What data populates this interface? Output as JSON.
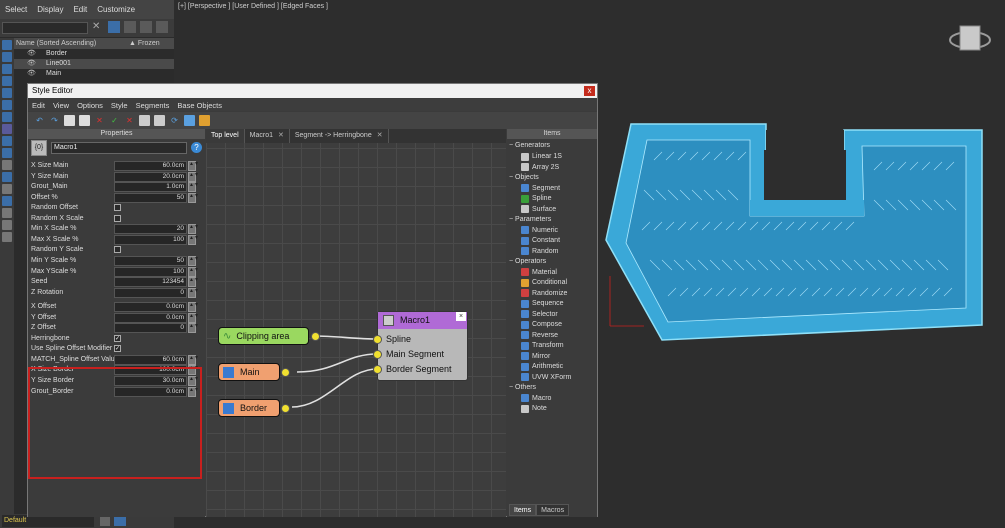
{
  "main_menu": [
    "Select",
    "Display",
    "Edit",
    "Customize"
  ],
  "scene_explorer": {
    "column_name": "Name (Sorted Ascending)",
    "column_frozen": "▲ Frozen",
    "rows": [
      "Border",
      "Line001",
      "Main"
    ]
  },
  "viewport_label": "[+] [Perspective ] [User Defined ] [Edged Faces ]",
  "status_selector": "Default",
  "style_editor": {
    "title": "Style Editor",
    "close": "x",
    "menu": [
      "Edit",
      "View",
      "Options",
      "Style",
      "Segments",
      "Base Objects"
    ],
    "properties_header": "Properties",
    "macro_name": "Macro1",
    "macro_icon_text": "{0}",
    "properties": [
      {
        "label": "X Size Main",
        "value": "60.0cm",
        "type": "num"
      },
      {
        "label": "Y  Size  Main",
        "value": "20.0cm",
        "type": "num"
      },
      {
        "label": "Grout_Main",
        "value": "1.0cm",
        "type": "num"
      },
      {
        "label": "Offset %",
        "value": "50",
        "type": "num"
      },
      {
        "label": "Random Offset",
        "value": "",
        "type": "check"
      },
      {
        "label": "Random X Scale",
        "value": "",
        "type": "check"
      },
      {
        "label": "Min X Scale %",
        "value": "20",
        "type": "num"
      },
      {
        "label": "Max X Scale %",
        "value": "100",
        "type": "num"
      },
      {
        "label": "Random Y Scale",
        "value": "",
        "type": "check"
      },
      {
        "label": "Min Y Scale %",
        "value": "50",
        "type": "num"
      },
      {
        "label": "Max YScale %",
        "value": "100",
        "type": "num"
      },
      {
        "label": "Seed",
        "value": "123454",
        "type": "num"
      },
      {
        "label": "Z Rotation",
        "value": "0",
        "type": "num"
      },
      {
        "label": "X Offset",
        "value": "0.0cm",
        "type": "num"
      },
      {
        "label": "Y Offset",
        "value": "0.0cm",
        "type": "num"
      },
      {
        "label": "Z Offset",
        "value": "0",
        "type": "num"
      },
      {
        "label": "Herringbone",
        "value": "✓",
        "type": "check"
      },
      {
        "label": "Use Spline Offset Modifier",
        "value": "✓",
        "type": "check"
      },
      {
        "label": "MATCH_Spline Offset Value!",
        "value": "60.0cm",
        "type": "num"
      },
      {
        "label": "X Size Border",
        "value": "100.0cm",
        "type": "num"
      },
      {
        "label": "Y Size Border",
        "value": "30.0cm",
        "type": "num"
      },
      {
        "label": "Grout_Border",
        "value": "0.0cm",
        "type": "num"
      }
    ],
    "tabs": [
      {
        "label": "Top level",
        "closable": false
      },
      {
        "label": "Macro1",
        "closable": true
      },
      {
        "label": "Segment -> Herringbone",
        "closable": true
      }
    ],
    "nodes": {
      "clipping": "Clipping area",
      "main": "Main",
      "border": "Border",
      "macro_title": "Macro1",
      "ports": [
        "Spline",
        "Main Segment",
        "Border Segment"
      ]
    },
    "items_header": "Items",
    "items": [
      {
        "category": "Generators",
        "entries": [
          {
            "label": "Linear 1S",
            "icon_color": "#c8c8c8"
          },
          {
            "label": "Array 2S",
            "icon_color": "#c8c8c8"
          }
        ]
      },
      {
        "category": "Objects",
        "entries": [
          {
            "label": "Segment",
            "icon_color": "#4a86d0"
          },
          {
            "label": "Spline",
            "icon_color": "#3aa03a"
          },
          {
            "label": "Surface",
            "icon_color": "#c8c8c8"
          }
        ]
      },
      {
        "category": "Parameters",
        "entries": [
          {
            "label": "Numeric",
            "icon_color": "#4a86d0"
          },
          {
            "label": "Constant",
            "icon_color": "#4a86d0"
          },
          {
            "label": "Random",
            "icon_color": "#4a86d0"
          }
        ]
      },
      {
        "category": "Operators",
        "entries": [
          {
            "label": "Material",
            "icon_color": "#d04040"
          },
          {
            "label": "Conditional",
            "icon_color": "#e0a030"
          },
          {
            "label": "Randomize",
            "icon_color": "#d04040"
          },
          {
            "label": "Sequence",
            "icon_color": "#4a86d0"
          },
          {
            "label": "Selector",
            "icon_color": "#4a86d0"
          },
          {
            "label": "Compose",
            "icon_color": "#4a86d0"
          },
          {
            "label": "Reverse",
            "icon_color": "#4a86d0"
          },
          {
            "label": "Transform",
            "icon_color": "#4a86d0"
          },
          {
            "label": "Mirror",
            "icon_color": "#4a86d0"
          },
          {
            "label": "Arithmetic",
            "icon_color": "#4a86d0"
          },
          {
            "label": "UVW XForm",
            "icon_color": "#4a86d0"
          }
        ]
      },
      {
        "category": "Others",
        "entries": [
          {
            "label": "Macro",
            "icon_color": "#4a86d0"
          },
          {
            "label": "Note",
            "icon_color": "#c8c8c8"
          }
        ]
      }
    ],
    "items_tabs": [
      "Items",
      "Macros"
    ]
  }
}
